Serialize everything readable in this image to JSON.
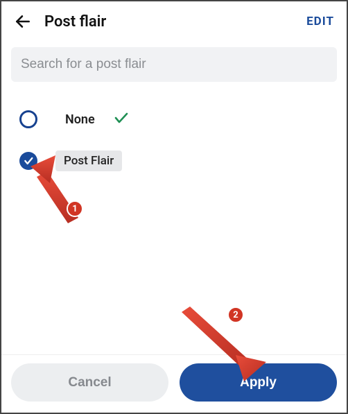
{
  "header": {
    "title": "Post flair",
    "edit_label": "EDIT",
    "back_icon": "back-arrow"
  },
  "search": {
    "placeholder": "Search for a post flair",
    "value": ""
  },
  "options": [
    {
      "label": "None",
      "selected": false,
      "applied": true
    },
    {
      "label": "Post Flair",
      "selected": true,
      "is_chip": true
    }
  ],
  "footer": {
    "cancel_label": "Cancel",
    "apply_label": "Apply"
  },
  "annotations": {
    "badge1": "1",
    "badge2": "2"
  }
}
